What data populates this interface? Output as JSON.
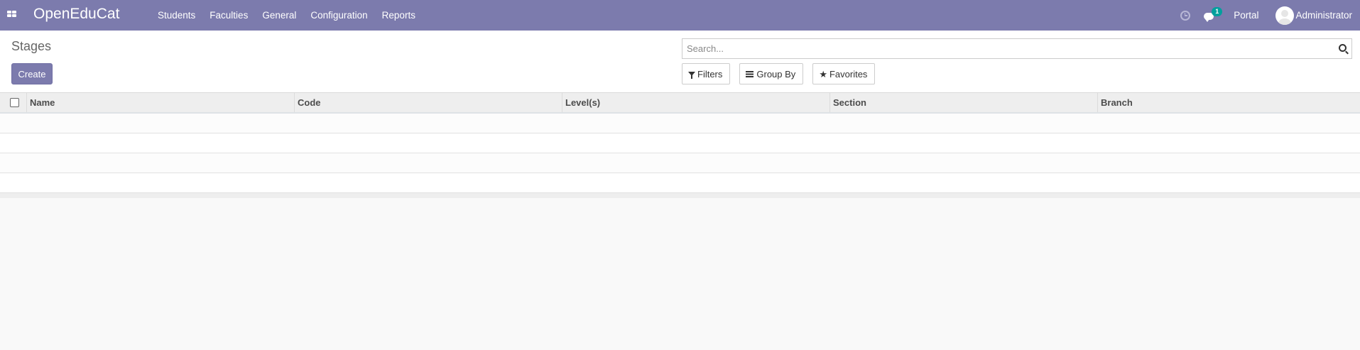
{
  "navbar": {
    "brand": "OpenEduCat",
    "menu": [
      "Students",
      "Faculties",
      "General",
      "Configuration",
      "Reports"
    ],
    "chat_badge": "1",
    "portal_label": "Portal",
    "user_name": "Administrator",
    "bg_color": "#7c7bad"
  },
  "control_panel": {
    "breadcrumb": "Stages",
    "create_label": "Create",
    "search_placeholder": "Search...",
    "filters_label": "Filters",
    "group_by_label": "Group By",
    "favorites_label": "Favorites"
  },
  "table": {
    "columns": [
      "Name",
      "Code",
      "Level(s)",
      "Section",
      "Branch"
    ],
    "rows": []
  },
  "icons": {
    "apps": "apps-grid-icon",
    "activity": "clock-icon",
    "messaging": "chat-icon",
    "search": "search-icon",
    "filter": "filter-icon",
    "group_by": "bars-icon",
    "favorites": "star-icon"
  }
}
